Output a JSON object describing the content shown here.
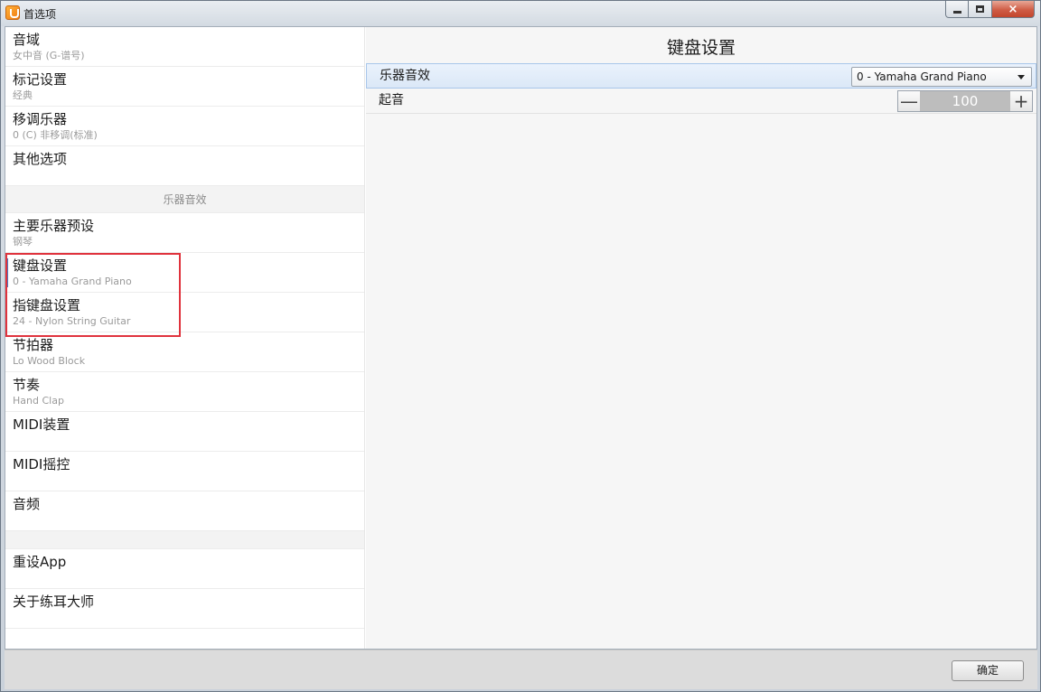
{
  "window": {
    "title": "首选项",
    "close_label": "×"
  },
  "sidebar": {
    "group1": [
      {
        "label": "音域",
        "sub": "女中音 (G-谱号)"
      },
      {
        "label": "标记设置",
        "sub": "经典"
      },
      {
        "label": "移调乐器",
        "sub": "0 (C) 非移调(标准)"
      },
      {
        "label": "其他选项",
        "sub": ""
      }
    ],
    "section_header": "乐器音效",
    "group2": [
      {
        "label": "主要乐器预设",
        "sub": "钢琴"
      },
      {
        "label": "键盘设置",
        "sub": "0 - Yamaha Grand Piano"
      },
      {
        "label": "指键盘设置",
        "sub": "24 - Nylon String Guitar"
      },
      {
        "label": "节拍器",
        "sub": "Lo Wood Block"
      },
      {
        "label": "节奏",
        "sub": "Hand Clap"
      },
      {
        "label": "MIDI装置",
        "sub": ""
      },
      {
        "label": "MIDI摇控",
        "sub": ""
      },
      {
        "label": "音频",
        "sub": ""
      }
    ],
    "group3": [
      {
        "label": "重设App",
        "sub": ""
      },
      {
        "label": "关于练耳大师",
        "sub": ""
      }
    ]
  },
  "content": {
    "title": "键盘设置",
    "instrument_label": "乐器音效",
    "instrument_value": "0 - Yamaha Grand Piano",
    "attack_label": "起音",
    "attack_value": "100",
    "minus_label": "—",
    "plus_label": "+"
  },
  "footer": {
    "ok_label": "确定"
  },
  "colors": {
    "accent": "#4a78c2",
    "highlight": "#e0333d",
    "selected_row": "#dbe8f7"
  }
}
